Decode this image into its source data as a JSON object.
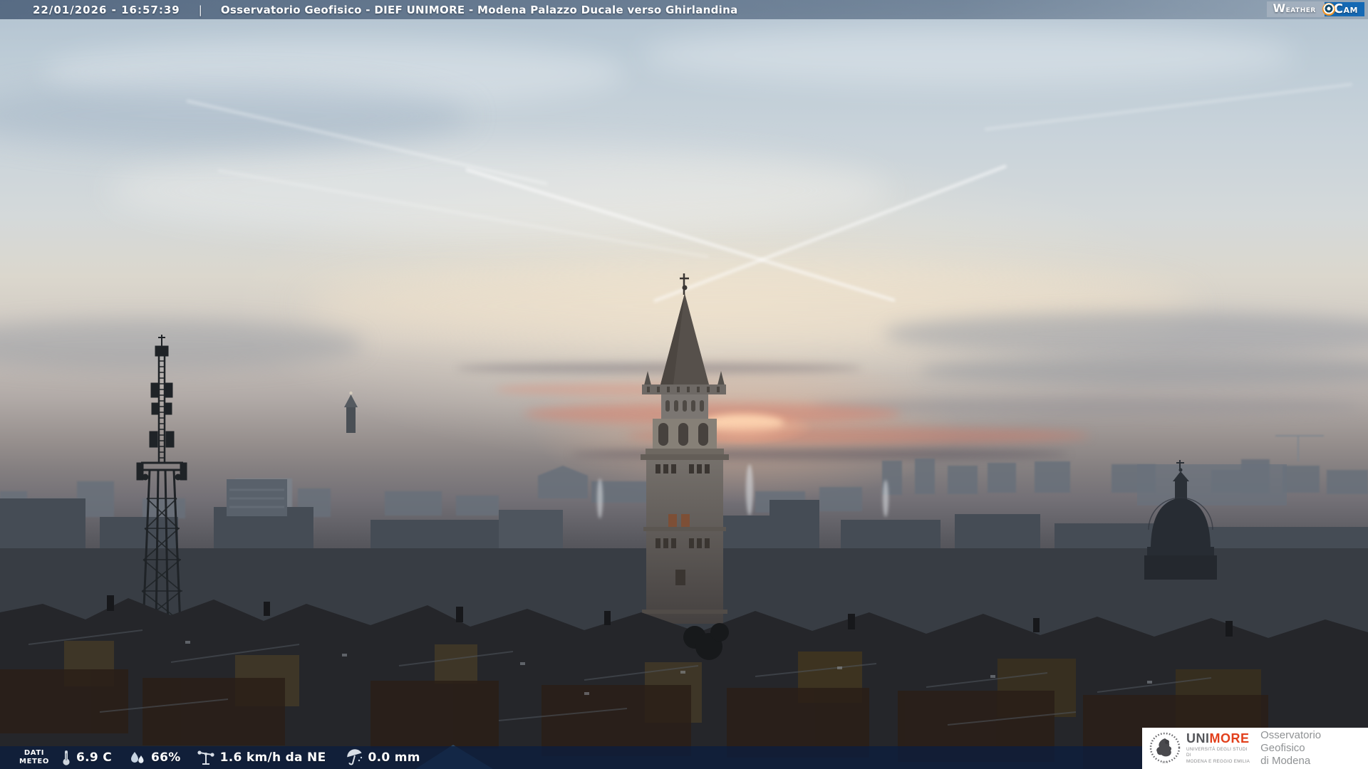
{
  "header": {
    "datetime": "22/01/2026 - 16:57:39",
    "separator": "|",
    "title": "Osservatorio Geofisico - DIEF UNIMORE - Modena Palazzo Ducale verso Ghirlandina",
    "weathercam_weather": "Weather",
    "weathercam_cam": "Cam"
  },
  "footer": {
    "dati_line1": "DATI",
    "dati_line2": "METEO",
    "temperature": "6.9 C",
    "humidity": "66%",
    "wind": "1.6 km/h da NE",
    "precipitation": "0.0 mm"
  },
  "branding": {
    "uni": "UNI",
    "more": "MORE",
    "sub_line1": "UNIVERSITÀ DEGLI STUDI DI",
    "sub_line2": "MODENA E REGGIO EMILIA",
    "observatory_line1": "Osservatorio Geofisico",
    "observatory_line2": "di Modena"
  },
  "colors": {
    "cam_box_blue": "#1569b4",
    "lens_orange": "#ef9425",
    "unimore_orange": "#e2401c",
    "bottom_bar_navy": "rgba(12,30,62,0.78)",
    "top_bar_slate": "rgba(40,62,92,0.66)"
  }
}
